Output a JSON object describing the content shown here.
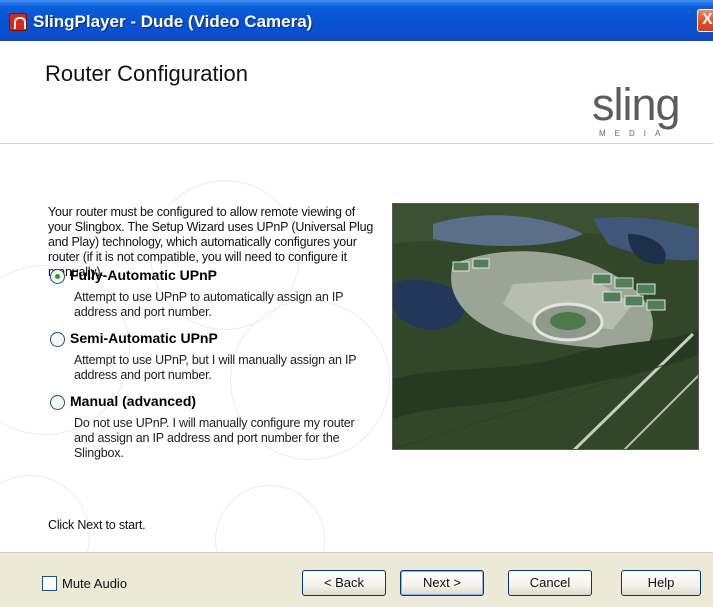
{
  "window": {
    "title": "SlingPlayer - Dude (Video Camera)",
    "close_label": "X"
  },
  "header": {
    "title": "Router Configuration",
    "logo_word": "sling",
    "logo_sub": "MEDIA"
  },
  "content": {
    "intro": "Your router must be configured to allow remote viewing of your Slingbox. The Setup Wizard uses UPnP (Universal Plug and Play) technology, which automatically configures your router (if it is not compatible, you will need to configure it manually).",
    "options": [
      {
        "label": "Fully-Automatic UPnP",
        "description": "Attempt to use UPnP to automatically assign an IP address and port number.",
        "selected": true
      },
      {
        "label": "Semi-Automatic UPnP",
        "description": "Attempt to use UPnP, but I will manually assign an IP address and port number.",
        "selected": false
      },
      {
        "label": "Manual (advanced)",
        "description": "Do not use UPnP. I will manually configure my router and assign an IP address and port number for the Slingbox.",
        "selected": false
      }
    ],
    "footer_note": "Click Next to start."
  },
  "footer": {
    "mute_label": "Mute Audio",
    "mute_checked": false,
    "back_label": "< Back",
    "next_label": "Next >",
    "cancel_label": "Cancel",
    "help_label": "Help"
  },
  "colors": {
    "titlebar": "#0653d6",
    "footer_bg": "#ece9d8",
    "radio_selected": "#21a121"
  }
}
